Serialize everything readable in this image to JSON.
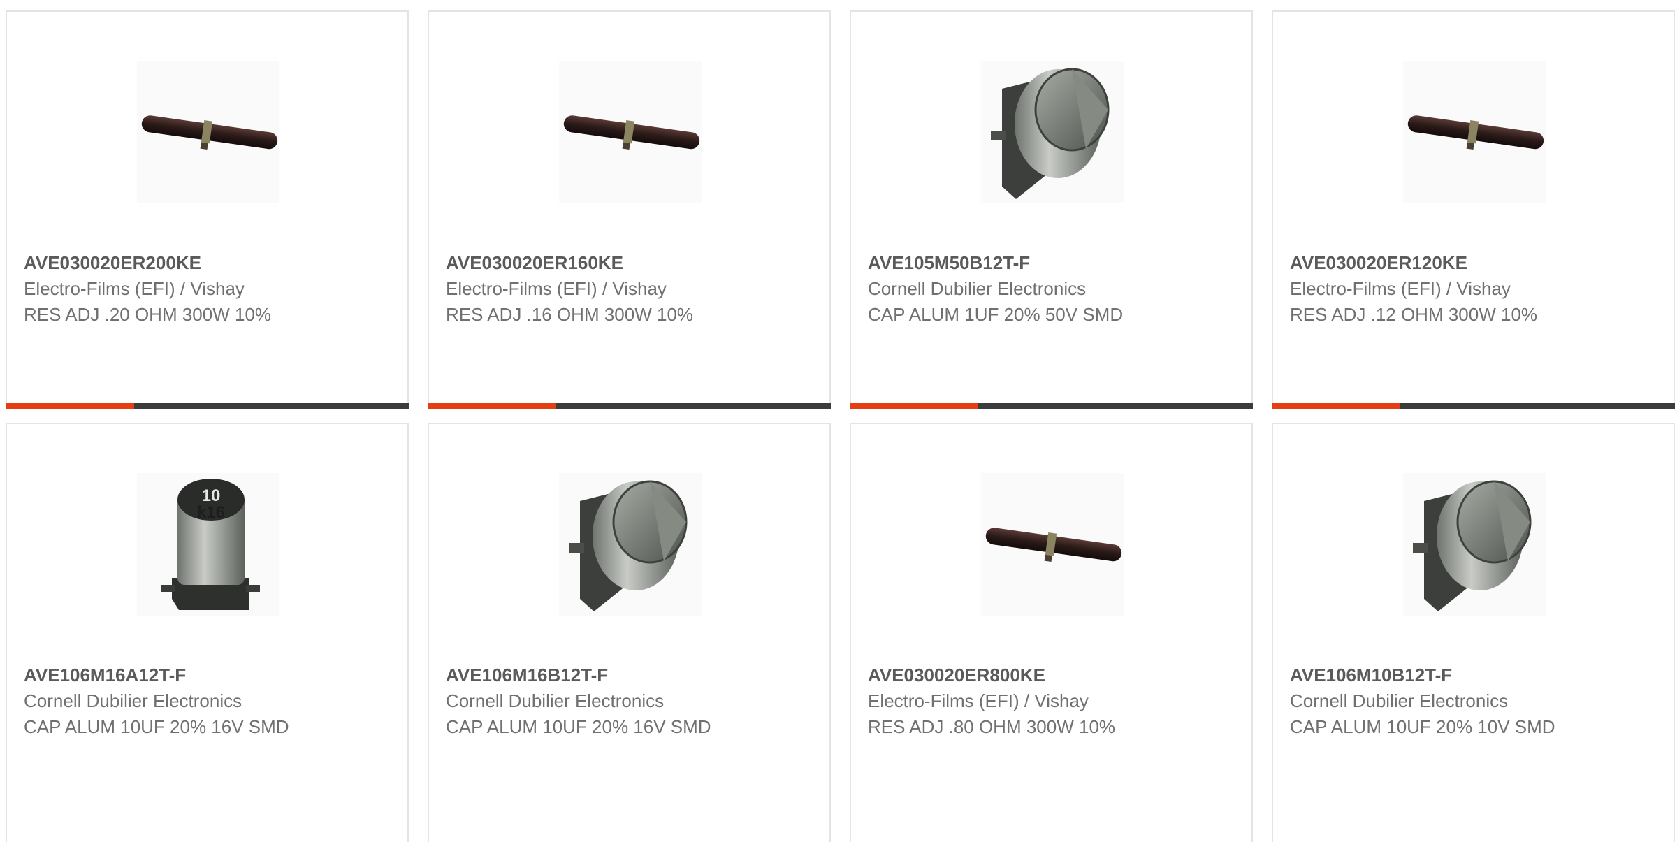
{
  "colors": {
    "accent": "#e53e12",
    "bar": "#3b3b3b",
    "border": "#e4e4e4",
    "title": "#5a5a5a",
    "text": "#707070"
  },
  "products": [
    {
      "part_number": "AVE030020ER200KE",
      "manufacturer": "Electro-Films (EFI) / Vishay",
      "description": "RES ADJ .20 OHM 300W 10%",
      "image": "resistor-icon"
    },
    {
      "part_number": "AVE030020ER160KE",
      "manufacturer": "Electro-Films (EFI) / Vishay",
      "description": "RES ADJ .16 OHM 300W 10%",
      "image": "resistor-icon"
    },
    {
      "part_number": "AVE105M50B12T-F",
      "manufacturer": "Cornell Dubilier Electronics",
      "description": "CAP ALUM 1UF 20% 50V SMD",
      "image": "smd-capacitor-icon"
    },
    {
      "part_number": "AVE030020ER120KE",
      "manufacturer": "Electro-Films (EFI) / Vishay",
      "description": "RES ADJ .12 OHM 300W 10%",
      "image": "resistor-icon"
    },
    {
      "part_number": "AVE106M16A12T-F",
      "manufacturer": "Cornell Dubilier Electronics",
      "description": "CAP ALUM 10UF 20% 16V SMD",
      "image": "capacitor-can-icon",
      "image_marking": [
        "10",
        "k16"
      ]
    },
    {
      "part_number": "AVE106M16B12T-F",
      "manufacturer": "Cornell Dubilier Electronics",
      "description": "CAP ALUM 10UF 20% 16V SMD",
      "image": "smd-capacitor-icon"
    },
    {
      "part_number": "AVE030020ER800KE",
      "manufacturer": "Electro-Films (EFI) / Vishay",
      "description": "RES ADJ .80 OHM 300W 10%",
      "image": "resistor-icon"
    },
    {
      "part_number": "AVE106M10B12T-F",
      "manufacturer": "Cornell Dubilier Electronics",
      "description": "CAP ALUM 10UF 20% 10V SMD",
      "image": "smd-capacitor-icon"
    }
  ]
}
